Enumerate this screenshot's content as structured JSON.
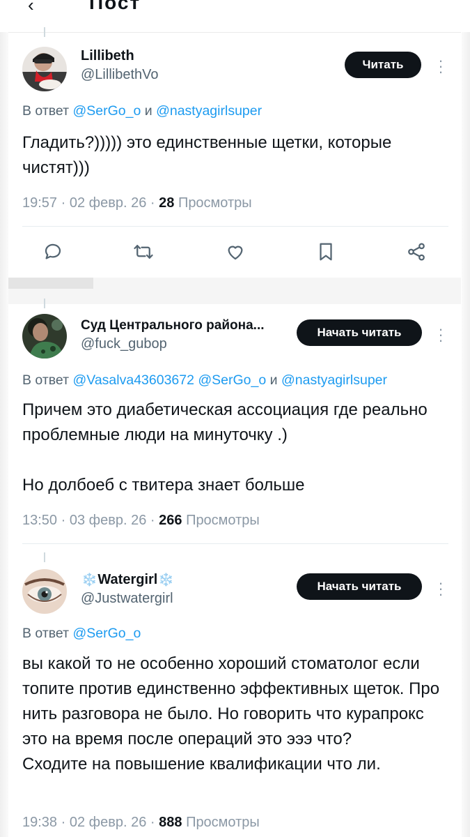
{
  "header": {
    "back_glyph": "‹",
    "title_partial": "Пост"
  },
  "tweets": [
    {
      "display_name": "Lillibeth",
      "handle": "@LillibethVo",
      "follow_label": "Читать",
      "reply_prefix": "В ответ",
      "mentions": [
        "@SerGo_o",
        "@nastyagirlsuper"
      ],
      "mention_joiner": "и",
      "body": [
        "Гладить?))))) это единственные щетки, которые чистят)))"
      ],
      "time": "19:57",
      "date": "02 февр. 26",
      "views": "28",
      "views_label": "Просмотры",
      "avatar_icon": "person-photo"
    },
    {
      "display_name": "Суд Центрального района...",
      "handle": "@fuck_gubop",
      "follow_label": "Начать читать",
      "reply_prefix": "В ответ",
      "mentions": [
        "@Vasalva43603672",
        "@SerGo_o",
        "@nastyagirlsuper"
      ],
      "mention_joiner": "и",
      "body": [
        "Причем это диабетическая ассоциация где реально проблемные люди на минуточку .)",
        "Но долбоеб с твитера знает больше"
      ],
      "time": "13:50",
      "date": "03 февр. 26",
      "views": "266",
      "views_label": "Просмотры",
      "avatar_icon": "person-photo"
    },
    {
      "display_name": "Watergirl",
      "display_name_decoration": "❄️",
      "handle": "@Justwatergirl",
      "follow_label": "Начать читать",
      "reply_prefix": "В ответ",
      "mentions": [
        "@SerGo_o"
      ],
      "mention_joiner": "",
      "body": [
        "вы какой то не особенно хороший стоматолог если топите против единственно эффективных щеток. Про нить разговора не было. Но говорить что курапрокс это на время после операций это эээ что?\nСходите на повышение квалификации что ли."
      ],
      "time": "19:38",
      "date": "02 февр. 26",
      "views": "888",
      "views_label": "Просмотры",
      "avatar_icon": "eye-photo"
    }
  ],
  "actions": [
    {
      "name": "reply-icon",
      "label": "Ответить"
    },
    {
      "name": "retweet-icon",
      "label": "Репост"
    },
    {
      "name": "like-icon",
      "label": "Нравится"
    },
    {
      "name": "bookmark-icon",
      "label": "Закладка"
    },
    {
      "name": "share-icon",
      "label": "Поделиться"
    }
  ],
  "colors": {
    "accent": "#1d9bf0",
    "text": "#0f1419",
    "secondary": "#536471",
    "button_bg": "#0f1419",
    "button_text": "#ffffff",
    "divider": "#e6ecf0"
  }
}
